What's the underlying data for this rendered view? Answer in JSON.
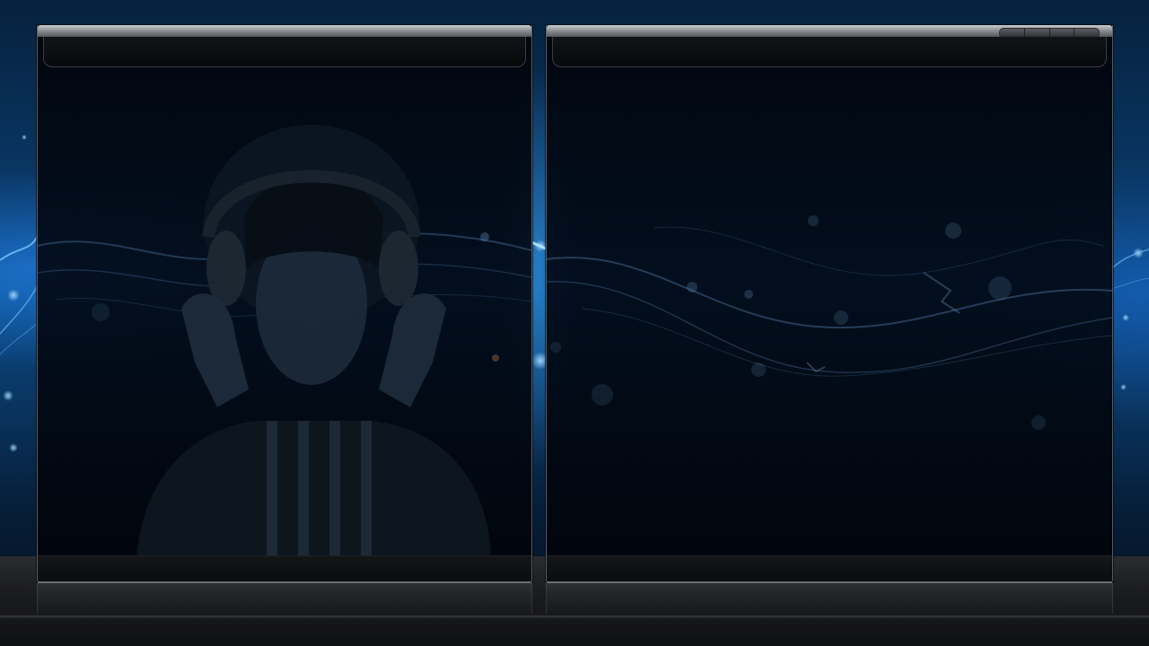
{
  "screen": {
    "accent_color": "#1e78e0",
    "background_color": "#0a3a6a",
    "frame_color": "#8d9095"
  },
  "left_panel": {
    "header_title": "",
    "image_icon": "person-with-headphones-image"
  },
  "right_panel": {
    "header_title": "",
    "window_controls": [
      {
        "icon": "control-button-1-icon"
      },
      {
        "icon": "control-button-2-icon"
      },
      {
        "icon": "control-button-3-icon"
      },
      {
        "icon": "control-button-4-icon"
      }
    ]
  }
}
